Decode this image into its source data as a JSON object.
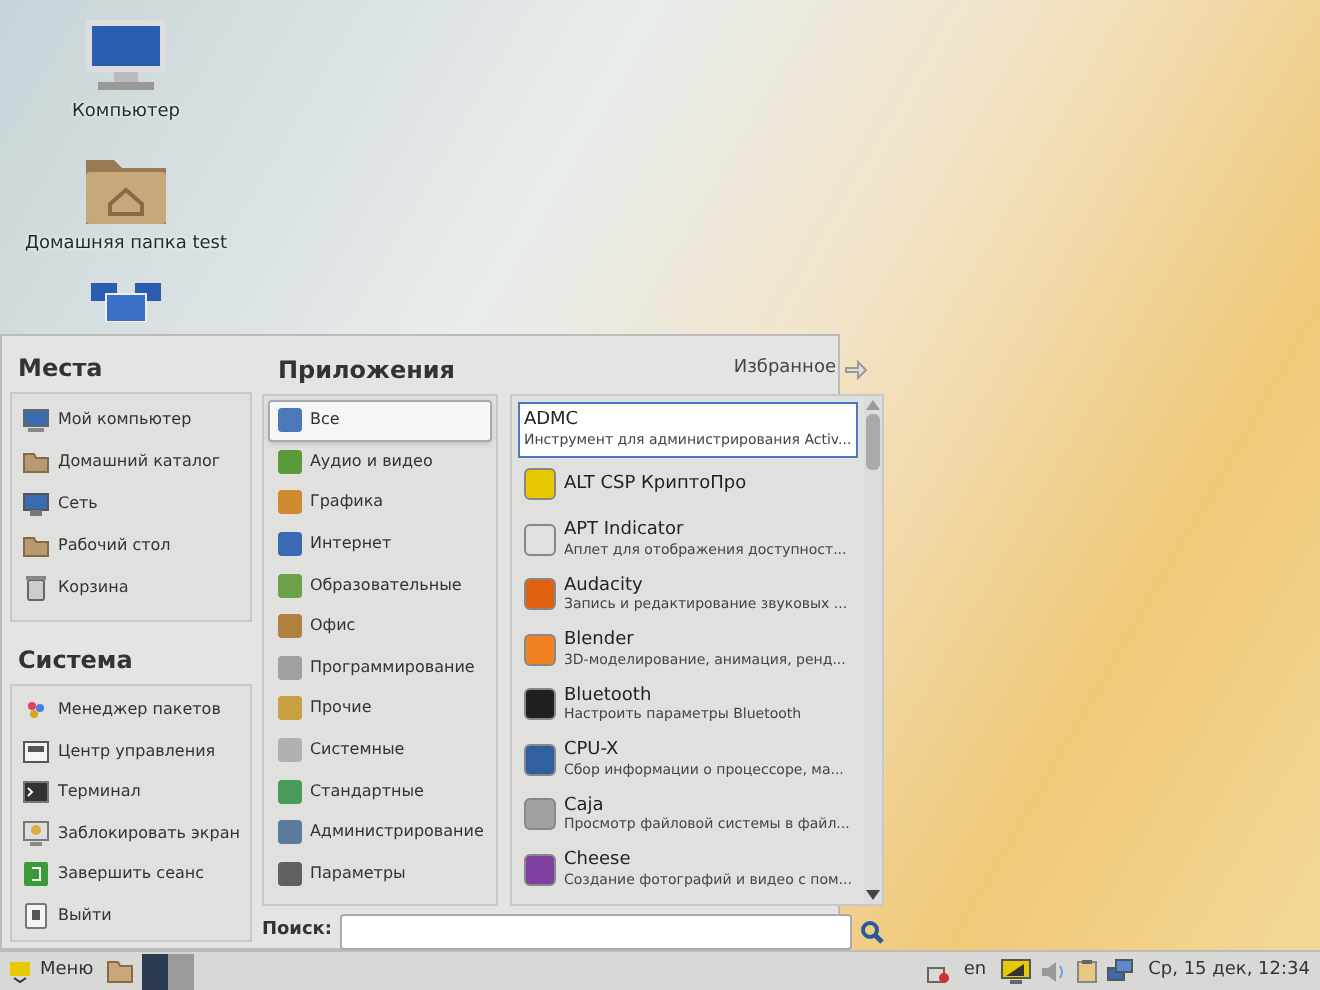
{
  "desktop": {
    "icons": [
      {
        "kind": "computer",
        "label": "Компьютер"
      },
      {
        "kind": "folder",
        "label": "Домашняя папка test"
      },
      {
        "kind": "network"
      }
    ]
  },
  "menu": {
    "places": {
      "title": "Места",
      "items": [
        {
          "kind": "computer",
          "label": "Мой компьютер"
        },
        {
          "kind": "folder",
          "label": "Домашний каталог"
        },
        {
          "kind": "network",
          "label": "Сеть"
        },
        {
          "kind": "folder",
          "label": "Рабочий стол"
        },
        {
          "kind": "trash",
          "label": "Корзина"
        }
      ]
    },
    "system": {
      "title": "Система",
      "items": [
        {
          "kind": "package",
          "label": "Менеджер пакетов"
        },
        {
          "kind": "control",
          "label": "Центр управления"
        },
        {
          "kind": "terminal",
          "label": "Терминал"
        },
        {
          "kind": "lock",
          "label": "Заблокировать экран"
        },
        {
          "kind": "logout",
          "label": "Завершить сеанс"
        },
        {
          "kind": "exit",
          "label": "Выйти"
        }
      ]
    },
    "applications": {
      "title": "Приложения",
      "favorites": "Избранное",
      "categories": [
        {
          "label": "Все",
          "selected": true,
          "color": "#4a78b8"
        },
        {
          "label": "Аудио и видео",
          "selected": false,
          "color": "#5a9a3a"
        },
        {
          "label": "Графика",
          "selected": false,
          "color": "#d08a30"
        },
        {
          "label": "Интернет",
          "selected": false,
          "color": "#3a6ab0"
        },
        {
          "label": "Образовательные",
          "selected": false,
          "color": "#6aa04a"
        },
        {
          "label": "Офис",
          "selected": false,
          "color": "#b08040"
        },
        {
          "label": "Программирование",
          "selected": false,
          "color": "#a0a0a0"
        },
        {
          "label": "Прочие",
          "selected": false,
          "color": "#c8a040"
        },
        {
          "label": "Системные",
          "selected": false,
          "color": "#b0b0b0"
        },
        {
          "label": "Стандартные",
          "selected": false,
          "color": "#4a9a5a"
        },
        {
          "label": "Администрирование",
          "selected": false,
          "color": "#5a7aa0"
        },
        {
          "label": "Параметры",
          "selected": false,
          "color": "#606060"
        }
      ],
      "apps": [
        {
          "name": "ADMC",
          "description": "Инструмент для администрирования Activ...",
          "selected": true
        },
        {
          "name": "ALT CSP КриптоПро",
          "selected": false,
          "color": "#e8c800"
        },
        {
          "name": "APT Indicator",
          "description": "Аплет для отображения доступност...",
          "selected": false,
          "color": "#e0e0e0"
        },
        {
          "name": "Audacity",
          "description": "Запись и редактирование звуковых ...",
          "selected": false,
          "color": "#e06010"
        },
        {
          "name": "Blender",
          "description": "3D-моделирование, анимация, ренд...",
          "selected": false,
          "color": "#f08020"
        },
        {
          "name": "Bluetooth",
          "description": "Настроить параметры Bluetooth",
          "selected": false,
          "color": "#202020"
        },
        {
          "name": "CPU-X",
          "description": "Сбор информации о процессоре, ма...",
          "selected": false,
          "color": "#3060a0"
        },
        {
          "name": "Caja",
          "description": "Просмотр файловой системы в файл...",
          "selected": false,
          "color": "#a0a0a0"
        },
        {
          "name": "Cheese",
          "description": "Создание фотографий и видео с пом...",
          "selected": false,
          "color": "#8040a0"
        }
      ]
    },
    "search": {
      "label": "Поиск:"
    }
  },
  "taskbar": {
    "menu_label": "Меню",
    "language": "en",
    "clock": "Ср, 15 дек, 12:34"
  }
}
